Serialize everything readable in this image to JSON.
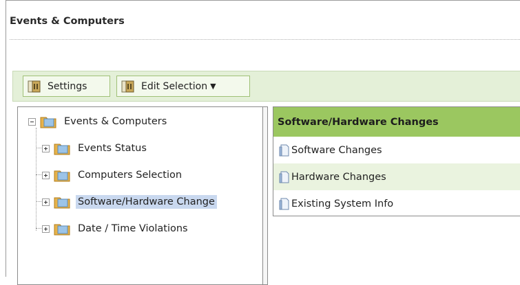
{
  "panel": {
    "title": "Events & Computers"
  },
  "toolbar": {
    "settings_label": "Settings",
    "edit_selection_label": "Edit Selection"
  },
  "tree": {
    "root": "Events & Computers",
    "children": [
      "Events Status",
      "Computers Selection",
      "Software/Hardware Change",
      "Date / Time Violations"
    ],
    "selected_index": 2
  },
  "list": {
    "header": "Software/Hardware Changes",
    "items": [
      "Software Changes",
      "Hardware Changes",
      "Existing System Info"
    ]
  },
  "colors": {
    "accent_green": "#9bc760",
    "toolbar_bg": "#e4f0d8",
    "selection": "#c9d8ef"
  },
  "icons": {
    "button": "report-icon",
    "folder": "folder-icon",
    "item": "document-icon"
  }
}
